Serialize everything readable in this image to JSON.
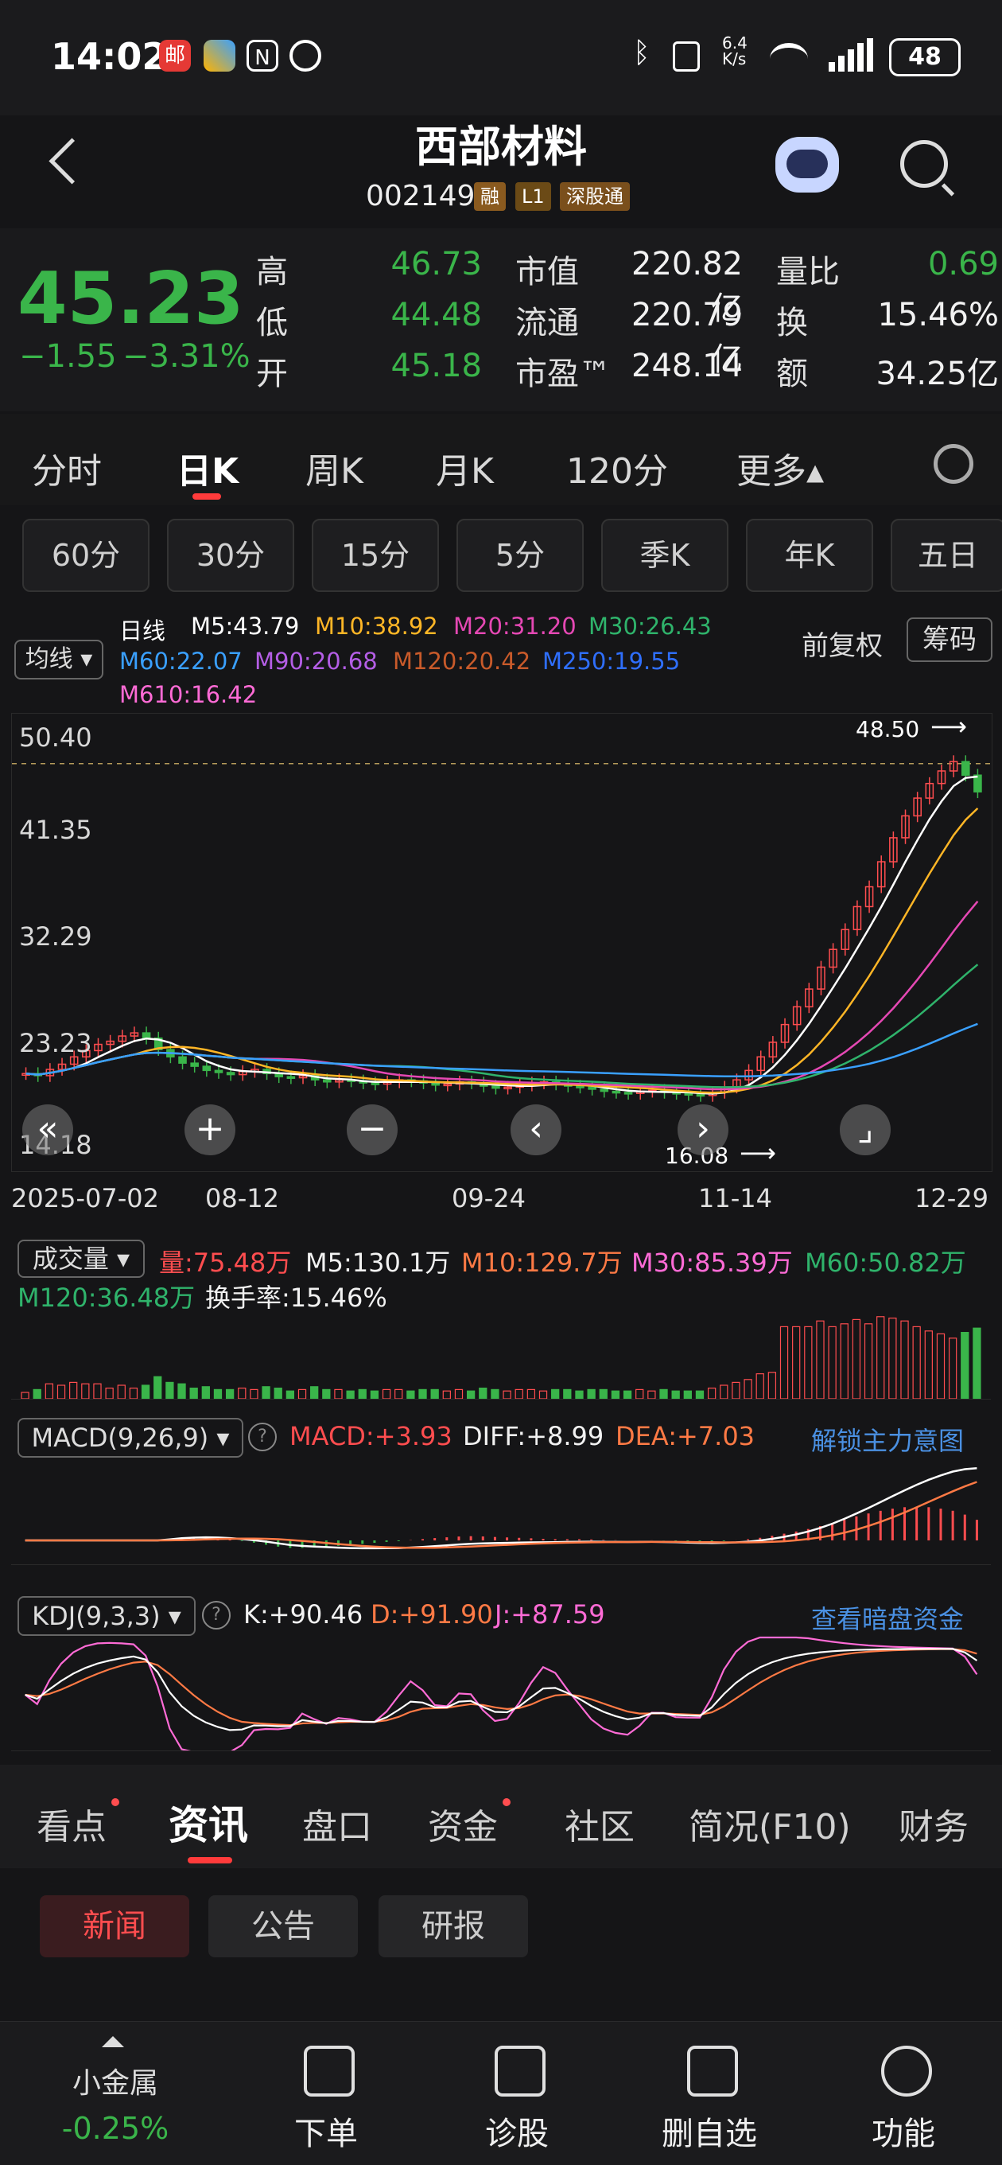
{
  "status_bar": {
    "time": "14:02",
    "net_speed": "6.4\nK/s",
    "battery": "48",
    "icons": [
      "app-mail-icon",
      "app-colors-icon",
      "nfc-icon",
      "alarm-icon",
      "bluetooth-icon",
      "vibrate-icon",
      "wifi-icon",
      "signal-icon"
    ]
  },
  "header": {
    "title": "西部材料",
    "code": "002149",
    "tags": [
      "融",
      "L1",
      "深股通"
    ]
  },
  "quote": {
    "price": "45.23",
    "change": "−1.55",
    "change_pct": "−3.31%",
    "high_label": "高",
    "high": "46.73",
    "low_label": "低",
    "low": "44.48",
    "open_label": "开",
    "open": "45.18",
    "mcap_label": "市值",
    "mcap": "220.82亿",
    "float_label": "流通",
    "float": "220.79亿",
    "pe_label": "市盈™",
    "pe": "248.14",
    "vr_label": "量比",
    "vr": "0.69",
    "turn_label": "换",
    "turn": "15.46%",
    "amt_label": "额",
    "amt": "34.25亿"
  },
  "tabs": [
    "分时",
    "日K",
    "周K",
    "月K",
    "120分",
    "更多▴"
  ],
  "periods": [
    "60分",
    "30分",
    "15分",
    "5分",
    "季K",
    "年K",
    "五日"
  ],
  "ma_legend": {
    "selector": "均线 ▾",
    "daily": "日线",
    "m5": "M5:43.79",
    "m10": "M10:38.92",
    "m20": "M20:31.20",
    "m30": "M30:26.43",
    "m60": "M60:22.07",
    "m90": "M90:20.68",
    "m120": "M120:20.42",
    "m250": "M250:19.55",
    "m610": "M610:16.42",
    "adjust": "前复权",
    "chips": "筹码"
  },
  "chart_data": {
    "type": "candlestick",
    "y_ticks": [
      "50.40",
      "41.35",
      "32.29",
      "23.23",
      "14.18"
    ],
    "x_ticks": [
      "2025-07-02",
      "08-12",
      "09-24",
      "11-14",
      "12-29"
    ],
    "max_label": "48.50",
    "min_label": "16.08",
    "ylim": [
      14.18,
      50.4
    ],
    "close": [
      18.2,
      18.0,
      18.6,
      19.1,
      19.8,
      20.4,
      21.0,
      21.3,
      21.8,
      22.1,
      21.6,
      20.5,
      19.8,
      19.2,
      18.9,
      18.5,
      18.3,
      18.1,
      18.4,
      18.6,
      18.2,
      17.9,
      17.8,
      18.0,
      17.6,
      17.4,
      17.6,
      17.5,
      17.3,
      17.2,
      17.4,
      17.6,
      17.5,
      17.3,
      17.1,
      17.2,
      17.4,
      17.3,
      17.0,
      16.8,
      16.9,
      17.1,
      17.3,
      17.4,
      17.2,
      17.0,
      16.9,
      16.7,
      16.5,
      16.4,
      16.3,
      16.5,
      16.6,
      16.4,
      16.3,
      16.2,
      16.1,
      16.4,
      16.9,
      17.6,
      18.5,
      19.8,
      21.2,
      22.9,
      24.6,
      26.3,
      28.4,
      30.1,
      32.0,
      34.2,
      36.1,
      38.5,
      40.8,
      42.9,
      44.6,
      46.0,
      47.2,
      48.1,
      46.8,
      45.2
    ]
  },
  "volume_legend": {
    "selector": "成交量 ▾",
    "vol": "量:75.48万",
    "m5": "M5:130.1万",
    "m10": "M10:129.7万",
    "m30": "M30:85.39万",
    "m60": "M60:50.82万",
    "m120": "M120:36.48万",
    "turnover": "换手率:15.46%"
  },
  "macd_legend": {
    "selector": "MACD(9,26,9) ▾",
    "macd": "MACD:+3.93",
    "diff": "DIFF:+8.99",
    "dea": "DEA:+7.03",
    "unlock": "解锁主力意图"
  },
  "kdj_legend": {
    "selector": "KDJ(9,3,3) ▾",
    "k": "K:+90.46",
    "d": "D:+91.90",
    "j": "J:+87.59",
    "dark": "查看暗盘资金"
  },
  "news_tabs": [
    "看点",
    "资讯",
    "盘口",
    "资金",
    "社区",
    "简况(F10)",
    "财务"
  ],
  "news_sub": [
    "新闻",
    "公告",
    "研报"
  ],
  "bottom_bar": {
    "ticker_name": "小金属",
    "ticker_pct": "-0.25%",
    "items": [
      "下单",
      "诊股",
      "删自选",
      "功能"
    ]
  },
  "colors": {
    "up": "#ff4d4f",
    "down": "#3ab54a",
    "bg": "#151517"
  }
}
